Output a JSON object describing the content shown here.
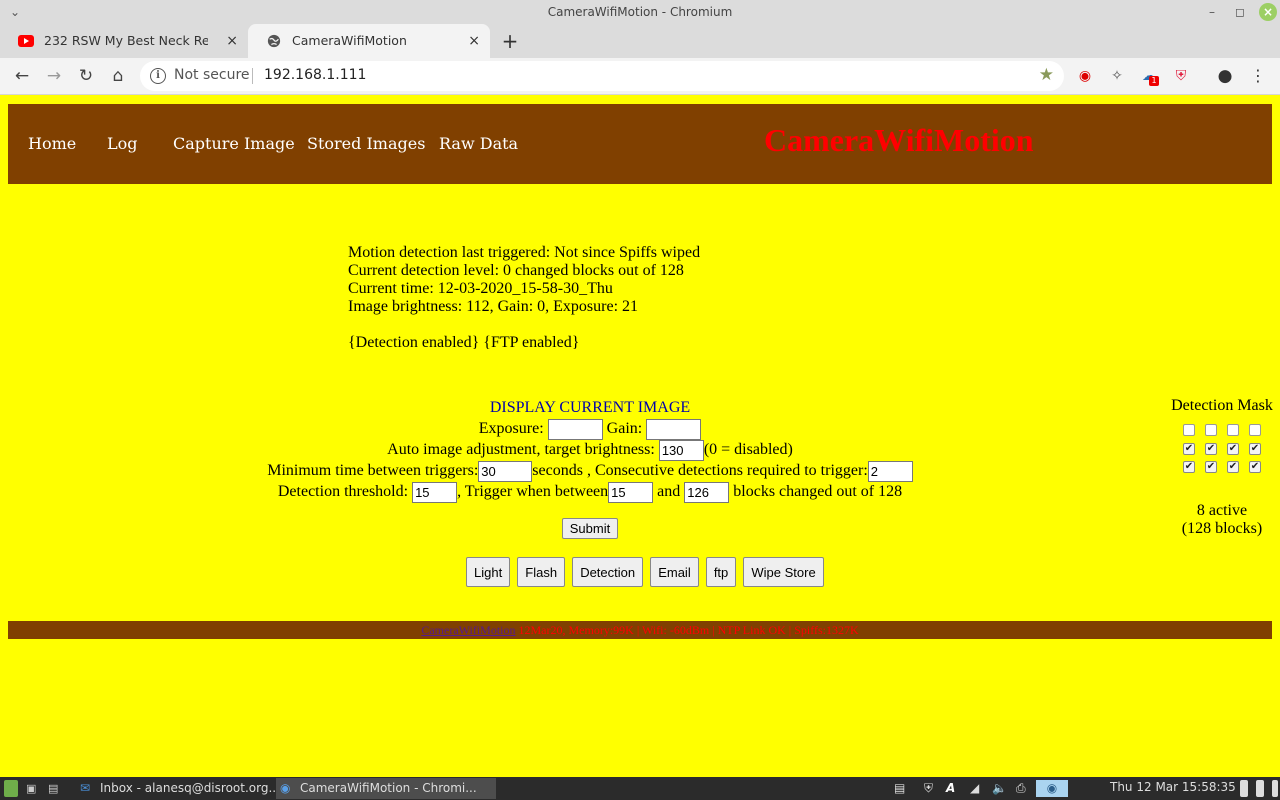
{
  "window": {
    "title": "CameraWifiMotion - Chromium"
  },
  "tabs": [
    {
      "label": "232 RSW My Best Neck Repair Vi",
      "icon": "youtube-icon"
    },
    {
      "label": "CameraWifiMotion",
      "icon": "globe-icon"
    }
  ],
  "omnibox": {
    "security": "Not secure",
    "url": "192.168.1.111"
  },
  "nav": {
    "home": "Home",
    "log": "Log",
    "capture": "Capture Image",
    "stored": "Stored Images",
    "raw": "Raw Data"
  },
  "brand": "CameraWifiMotion",
  "status": {
    "line1": "Motion detection last triggered: Not since Spiffs wiped",
    "line2": "Current detection level: 0 changed blocks out of 128",
    "line3": "Current time: 12-03-2020_15-58-30_Thu",
    "line4": "Image brightness: 112, Gain: 0, Exposure: 21",
    "flags": "{Detection enabled} {FTP enabled}"
  },
  "form": {
    "display_link": "DISPLAY CURRENT IMAGE",
    "exposure_label": "Exposure:",
    "gain_label": "Gain:",
    "exposure_value": "",
    "gain_value": "",
    "auto_label": "Auto image adjustment, target brightness:",
    "auto_value": "130",
    "auto_suffix": "(0 = disabled)",
    "min_time_label": "Minimum time between triggers:",
    "min_time_value": "30",
    "seconds_label": "seconds , Consecutive detections required to trigger:",
    "consecutive_value": "2",
    "threshold_label": "Detection threshold:",
    "threshold_value": "15",
    "trigger_label": ", Trigger when between",
    "trigger_low": "15",
    "and_label": "and",
    "trigger_high": "126",
    "blocks_label": "blocks changed out of 128",
    "submit": "Submit"
  },
  "buttons": {
    "light": "Light",
    "flash": "Flash",
    "detection": "Detection",
    "email": "Email",
    "ftp": "ftp",
    "wipe": "Wipe Store"
  },
  "mask": {
    "title": "Detection Mask",
    "rows": [
      [
        false,
        false,
        false,
        false
      ],
      [
        true,
        true,
        true,
        true
      ],
      [
        true,
        true,
        true,
        true
      ]
    ],
    "active": "8 active",
    "blocks": "(128 blocks)"
  },
  "footer": {
    "link": "CameraWifiMotion",
    "text": " 12Mar20, Memory:99K | Wifi: -60dBm | NTP Link OK | Spiffs:1327K"
  },
  "taskbar": {
    "tasks": [
      {
        "label": "Inbox - alanesq@disroot.org...",
        "icon": "thunderbird-icon"
      },
      {
        "label": "CameraWifiMotion - Chromi...",
        "icon": "chromium-icon"
      }
    ],
    "clock": "Thu 12 Mar 15:58:35"
  }
}
